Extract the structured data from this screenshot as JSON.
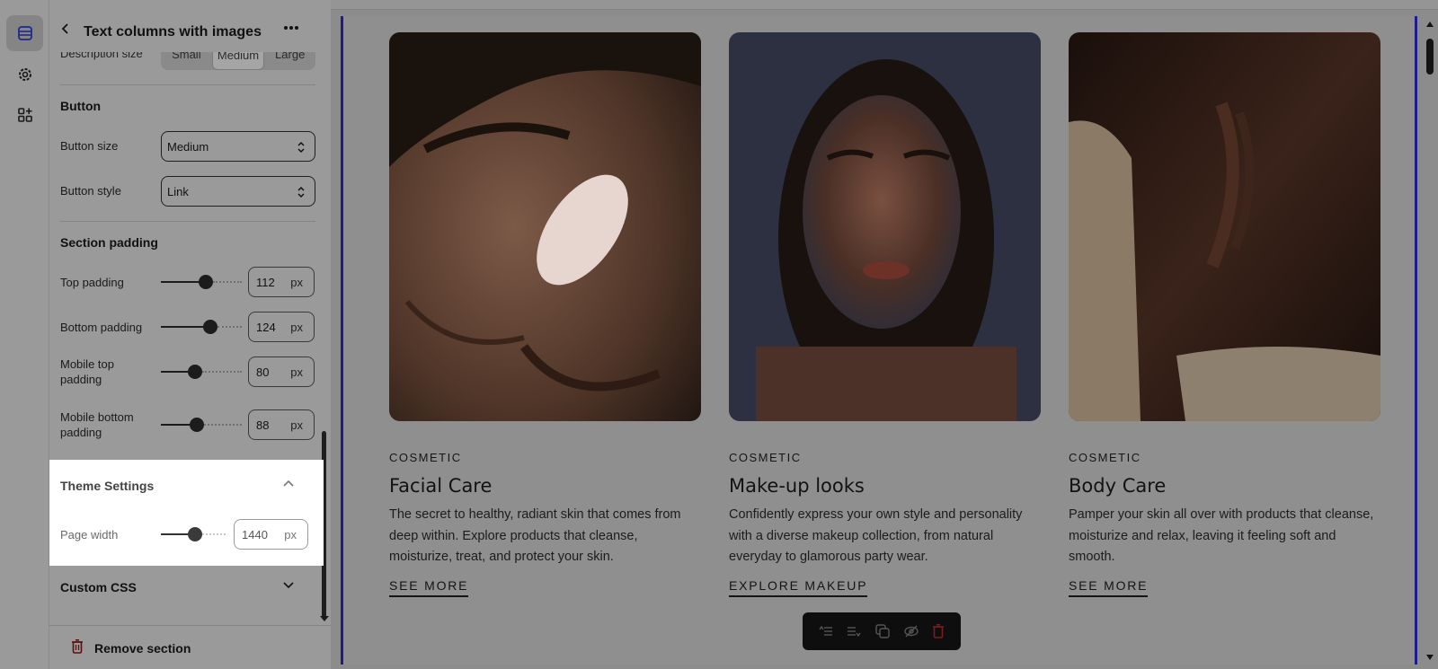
{
  "rail": {
    "items": [
      {
        "icon": "sections-icon",
        "active": true
      },
      {
        "icon": "gear-icon",
        "active": false
      },
      {
        "icon": "add-app-icon",
        "active": false
      }
    ]
  },
  "panel": {
    "title": "Text columns with images",
    "description_size": {
      "label": "Description size",
      "options": [
        "Small",
        "Medium",
        "Large"
      ],
      "selected": "Medium"
    },
    "button_section": {
      "heading": "Button",
      "size_label": "Button size",
      "size_value": "Medium",
      "style_label": "Button style",
      "style_value": "Link"
    },
    "padding_section": {
      "heading": "Section padding",
      "rows": [
        {
          "label": "Top padding",
          "value": "112",
          "unit": "px",
          "level": 0.56
        },
        {
          "label": "Bottom padding",
          "value": "124",
          "unit": "px",
          "level": 0.61
        },
        {
          "label": "Mobile top padding",
          "value": "80",
          "unit": "px",
          "level": 0.42
        },
        {
          "label": "Mobile bottom padding",
          "value": "88",
          "unit": "px",
          "level": 0.44
        }
      ]
    },
    "theme_settings": {
      "heading": "Theme Settings",
      "page_width_label": "Page width",
      "page_width_value": "1440",
      "unit": "px",
      "level": 0.53
    },
    "custom_css": {
      "heading": "Custom CSS"
    },
    "remove_label": "Remove section"
  },
  "preview": {
    "cards": [
      {
        "eyebrow": "COSMETIC",
        "title": "Facial Care",
        "text": "The secret to healthy, radiant skin that comes from deep within. Explore products that cleanse, moisturize, treat, and protect your skin.",
        "link": "SEE MORE"
      },
      {
        "eyebrow": "COSMETIC",
        "title": "Make-up looks",
        "text": "Confidently express your own style and personality with a diverse makeup collection, from natural everyday to glamorous party wear.",
        "link": "EXPLORE MAKEUP"
      },
      {
        "eyebrow": "COSMETIC",
        "title": "Body Care",
        "text": "Pamper your skin all over with products that cleanse, moisturize and relax, leaving it feeling soft and smooth.",
        "link": "SEE MORE"
      }
    ],
    "toolbar": {
      "icons": [
        "move-up-icon",
        "move-down-icon",
        "duplicate-icon",
        "hide-icon",
        "delete-icon"
      ],
      "delete_color": "#c0392b"
    }
  },
  "colors": {
    "accent": "#1d1d8a",
    "overlay": "#8f8f8f"
  }
}
